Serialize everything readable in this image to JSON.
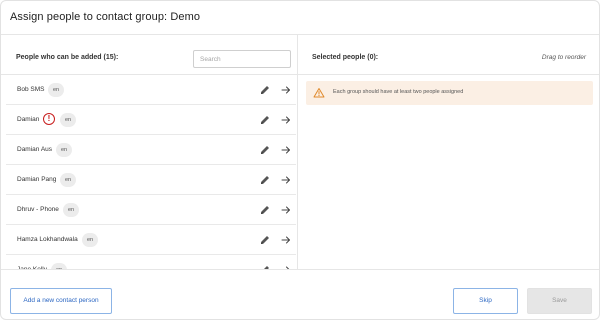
{
  "dialog": {
    "title": "Assign people to contact group: Demo"
  },
  "left_pane": {
    "title": "People who can be added (15):",
    "search_placeholder": "Search",
    "people": [
      {
        "name": "Bob SMS",
        "language": "en",
        "warning": false
      },
      {
        "name": "Damian",
        "language": "en",
        "warning": true,
        "warning_symbol": "!"
      },
      {
        "name": "Damian Aus",
        "language": "en",
        "warning": false
      },
      {
        "name": "Damian Pang",
        "language": "en",
        "warning": false
      },
      {
        "name": "Dhruv - Phone",
        "language": "en",
        "warning": false
      },
      {
        "name": "Hamza Lokhandwala",
        "language": "en",
        "warning": false
      },
      {
        "name": "Jane Kelly",
        "language": "en",
        "warning": false
      }
    ],
    "icons": {
      "edit": "pencil-icon",
      "add": "arrow-right-icon",
      "warning": "exclamation-circle-icon"
    }
  },
  "right_pane": {
    "title": "Selected people (0):",
    "reorder_hint": "Drag to reorder",
    "alert": {
      "icon": "warning-triangle-icon",
      "text": "Each group should have at least two people assigned"
    }
  },
  "footer": {
    "add_label": "Add a new contact person",
    "skip_label": "Skip",
    "save_label": "Save"
  },
  "colors": {
    "accent": "#2b66c2",
    "warning": "#c81e1e",
    "alert_bg": "#fbefe4",
    "alert_icon": "#e08a2c"
  }
}
